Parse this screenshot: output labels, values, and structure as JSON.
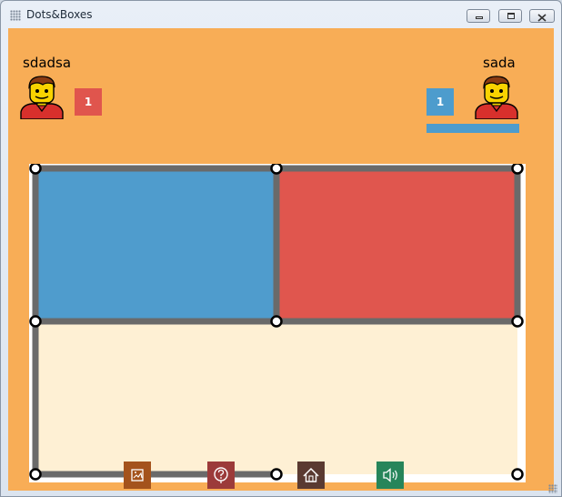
{
  "window": {
    "title": "Dots&Boxes"
  },
  "players": [
    {
      "name": "sdadsa",
      "score": "1",
      "color": "#e0554d"
    },
    {
      "name": "sada",
      "score": "1",
      "color": "#4d9ccd"
    }
  ],
  "board": {
    "dots_grid": "3x3",
    "box_fill_colors": {
      "blue": "#4f9ccd",
      "red": "#e0564e",
      "empty": "#fef0d4"
    },
    "line_color": "#6a6a6a",
    "boxes": [
      {
        "row": 0,
        "col": 0,
        "owner": "sada"
      },
      {
        "row": 0,
        "col": 1,
        "owner": "sdadsa"
      },
      {
        "row": 1,
        "col": 0,
        "owner": null
      },
      {
        "row": 1,
        "col": 1,
        "owner": null
      }
    ],
    "drawn_horizontal_lines": [
      [
        0,
        0
      ],
      [
        0,
        1
      ],
      [
        1,
        0
      ],
      [
        1,
        1
      ],
      [
        2,
        0
      ]
    ],
    "drawn_vertical_lines": [
      [
        0,
        0
      ],
      [
        0,
        1
      ],
      [
        0,
        2
      ],
      [
        1,
        0
      ]
    ]
  },
  "toolbar": [
    {
      "icon": "image-icon",
      "color": "#a4531c"
    },
    {
      "icon": "help-icon",
      "color": "#9c3b3a"
    },
    {
      "icon": "home-icon",
      "color": "#5a3a31"
    },
    {
      "icon": "sound-icon",
      "color": "#26855a"
    }
  ]
}
